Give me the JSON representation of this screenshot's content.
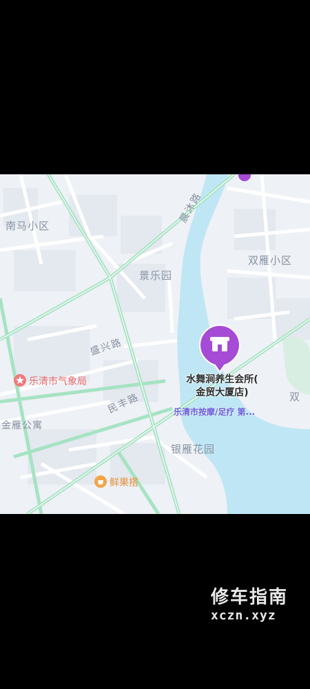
{
  "map": {
    "areas": [
      "南马小区",
      "景乐园",
      "双雁小区",
      "银雁花园",
      "双",
      "金雁公寓"
    ],
    "roads": [
      "晨沐路",
      "盛兴路",
      "民丰路"
    ],
    "pois": {
      "weather_bureau": "乐清市气象局",
      "fruit_shop": "鲜果搭"
    },
    "selected_poi": {
      "name": "水舞涧养生会所(金贸大厦店)",
      "name_line1": "水舞涧养生会所(",
      "name_line2": "金贸大厦店)",
      "category": "乐清市按摩/足疗 第..."
    },
    "colors": {
      "land": "#eef1f6",
      "water": "#bfe6f4",
      "main_road": "#a6e3c3",
      "pin": "#a54bd6"
    }
  },
  "watermark": {
    "line1": "修车指南",
    "line2": "xczn.xyz"
  }
}
